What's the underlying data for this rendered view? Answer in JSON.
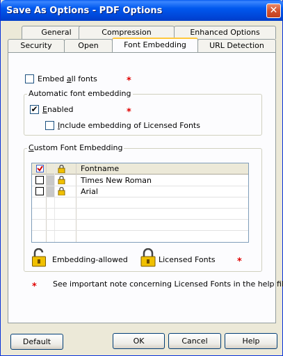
{
  "window": {
    "title": "Save As Options - PDF Options",
    "close_glyph": "✕"
  },
  "tabs": {
    "row1": [
      "General",
      "Compression",
      "Enhanced Options"
    ],
    "row2": [
      "Security",
      "Open",
      "Font Embedding",
      "URL Detection"
    ],
    "active": "Font Embedding"
  },
  "embed_all": {
    "label_pre": "Embed ",
    "label_accel": "a",
    "label_post": "ll fonts",
    "checked": false
  },
  "auto_group": {
    "title": "Automatic font embedding",
    "enabled_accel": "E",
    "enabled_rest": "nabled",
    "enabled_checked": true,
    "licensed_accel": "I",
    "licensed_rest": "nclude embedding of Licensed Fonts",
    "licensed_checked": false
  },
  "custom_group": {
    "title_accel": "C",
    "title_rest": "ustom Font Embedding",
    "columns": {
      "name": "Fontname"
    },
    "fonts": [
      {
        "name": "Times New Roman",
        "checked": false
      },
      {
        "name": "Arial",
        "checked": false
      }
    ]
  },
  "legend": {
    "allowed": "Embedding-allowed",
    "licensed": "Licensed Fonts"
  },
  "star": "*",
  "note": "See important note concerning Licensed Fonts in the help file!",
  "buttons": {
    "default": "Default",
    "ok": "OK",
    "cancel": "Cancel",
    "help": "Help"
  },
  "colors": {
    "title_bar": "#0054e3",
    "star": "#e00000",
    "lock": "#f0c000",
    "tab_highlight": "#ffc83c"
  },
  "icons": [
    "close-icon",
    "checkbox-icon",
    "lock-icon",
    "unlocked-icon"
  ]
}
